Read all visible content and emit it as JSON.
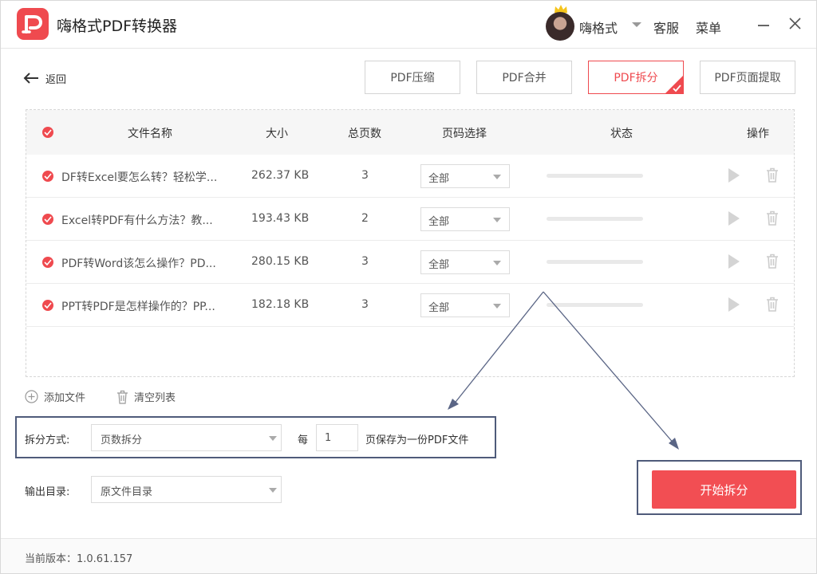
{
  "app": {
    "title": "嗨格式PDF转换器"
  },
  "header": {
    "username": "嗨格式",
    "service": "客服",
    "menu": "菜单"
  },
  "nav": {
    "back_label": "返回"
  },
  "tabs": [
    {
      "label": "PDF压缩",
      "active": false
    },
    {
      "label": "PDF合并",
      "active": false
    },
    {
      "label": "PDF拆分",
      "active": true
    },
    {
      "label": "PDF页面提取",
      "active": false
    }
  ],
  "table": {
    "headers": {
      "name": "文件名称",
      "size": "大小",
      "pages": "总页数",
      "range": "页码选择",
      "status": "状态",
      "ops": "操作"
    },
    "rows": [
      {
        "name": "DF转Excel要怎么转？轻松学...",
        "size": "262.37 KB",
        "pages": "3",
        "range": "全部"
      },
      {
        "name": "Excel转PDF有什么方法？教...",
        "size": "193.43 KB",
        "pages": "2",
        "range": "全部"
      },
      {
        "name": "PDF转Word该怎么操作？PD...",
        "size": "280.15 KB",
        "pages": "3",
        "range": "全部"
      },
      {
        "name": "PPT转PDF是怎样操作的？PP...",
        "size": "182.18 KB",
        "pages": "3",
        "range": "全部"
      }
    ]
  },
  "actions": {
    "add_files": "添加文件",
    "clear_list": "清空列表"
  },
  "split": {
    "method_label": "拆分方式:",
    "method_value": "页数拆分",
    "every_label": "每",
    "pages_per_file": "1",
    "suffix": "页保存为一份PDF文件"
  },
  "output": {
    "label": "输出目录:",
    "value": "原文件目录"
  },
  "start_button": "开始拆分",
  "footer": {
    "version": "当前版本：1.0.61.157"
  },
  "colors": {
    "accent": "#ef4a4f",
    "annotation": "#4f5b7a"
  }
}
